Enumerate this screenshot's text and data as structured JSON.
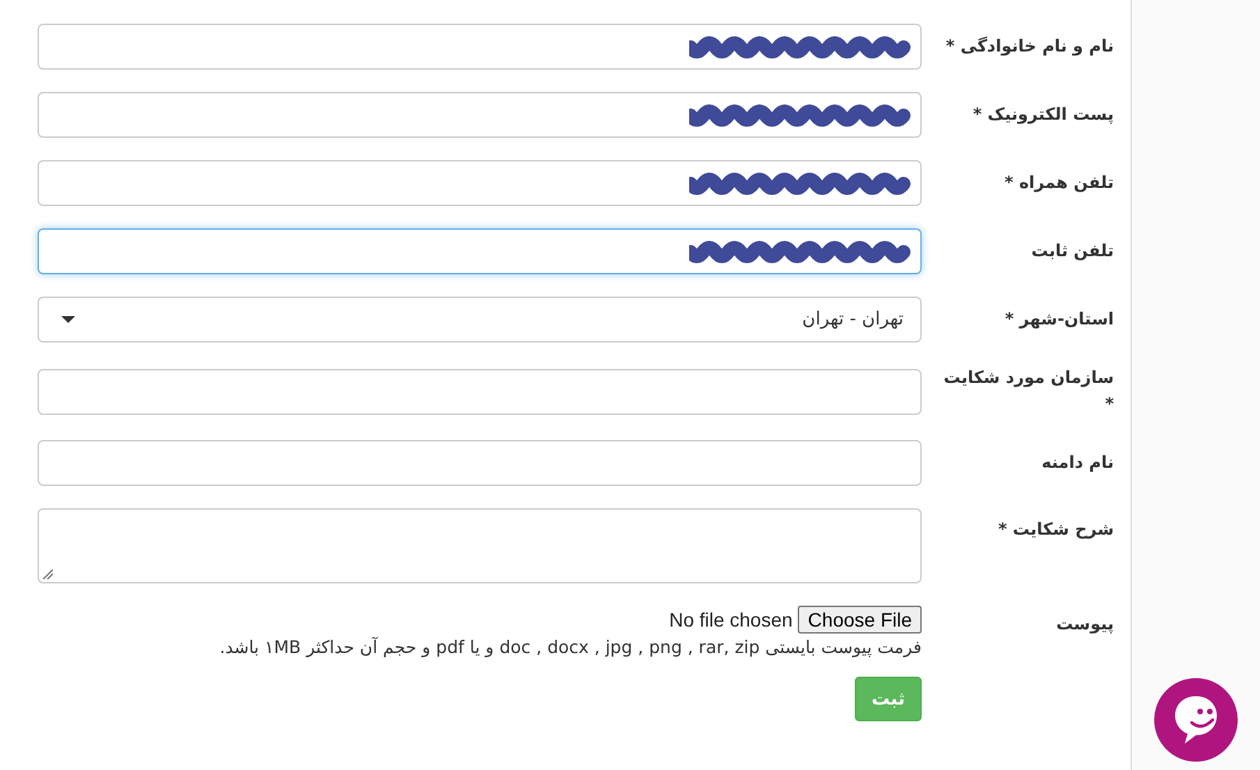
{
  "form": {
    "fields": [
      {
        "kind": "text",
        "label": "نام و نام خانوادگی *",
        "redacted": true,
        "focused": false
      },
      {
        "kind": "text",
        "label": "پست الکترونیک *",
        "redacted": true,
        "focused": false
      },
      {
        "kind": "text",
        "label": "تلفن همراه *",
        "redacted": true,
        "focused": false
      },
      {
        "kind": "text",
        "label": "تلفن ثابت",
        "redacted": true,
        "focused": true
      },
      {
        "kind": "select",
        "label": "استان-شهر *",
        "value": "تهران - تهران",
        "focused": false
      },
      {
        "kind": "text",
        "label": "سازمان مورد شکایت *",
        "redacted": false,
        "focused": false
      },
      {
        "kind": "text",
        "label": "نام دامنه",
        "redacted": false,
        "focused": false
      },
      {
        "kind": "textarea",
        "label": "شرح شکایت *",
        "focused": false
      },
      {
        "kind": "file",
        "label": "پیوست",
        "button": "Choose File",
        "status": "No file chosen",
        "hint": "فرمت پیوست بایستی doc , docx , jpg , png , rar, zip و یا pdf و حجم آن حداکثر ۱MB باشد."
      }
    ],
    "submit": "ثبت"
  },
  "chat_widget": {
    "kind": "chat"
  }
}
